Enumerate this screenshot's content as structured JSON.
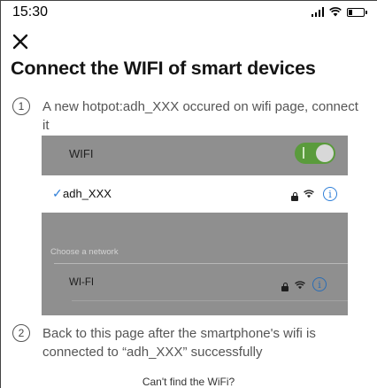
{
  "status_bar": {
    "time": "15:30",
    "icons": [
      "signal-icon",
      "wifi-icon",
      "battery-icon"
    ]
  },
  "header": {
    "close_icon": "close-icon",
    "title": "Connect the WIFI of smart devices"
  },
  "steps": [
    {
      "number": "1",
      "text": "A new hotpot:adh_XXX occured on wifi page, connect it"
    },
    {
      "number": "2",
      "text": "Back to this page after the smartphone's wifi is connected to “adh_XXX” successfully"
    }
  ],
  "illustration": {
    "wifi_label": "WIFI",
    "toggle_on": true,
    "connected_network": "adh_XXX",
    "check_mark": "✓",
    "section_label": "Choose a network",
    "other_network": "WI-FI",
    "info_glyph": "i",
    "colors": {
      "background": "#8f8f8f",
      "toggle": "#5a9b3c",
      "accent": "#2f7fd8"
    }
  },
  "footer": {
    "link_text": "Can't find the WiFi?"
  }
}
